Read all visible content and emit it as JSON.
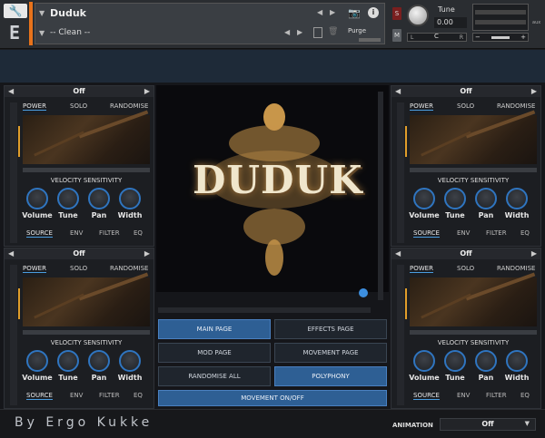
{
  "header": {
    "instrument_name": "Duduk",
    "preset_name": "-- Clean --",
    "purge_label": "Purge",
    "s_label": "S",
    "m_label": "M",
    "tune_label": "Tune",
    "tune_value": "0.00",
    "pan_left": "L",
    "pan_center": "C",
    "pan_right": "R",
    "aux_label": "aux"
  },
  "modules": [
    {
      "selector_value": "Off",
      "tabs": [
        "POWER",
        "SOLO",
        "RANDOMISE"
      ],
      "velocity_title": "VELOCITY SENSITIVITY",
      "knobs": [
        "Volume",
        "Tune",
        "Pan",
        "Width"
      ],
      "bottom_tabs": [
        "SOURCE",
        "ENV",
        "FILTER",
        "EQ"
      ]
    },
    {
      "selector_value": "Off",
      "tabs": [
        "POWER",
        "SOLO",
        "RANDOMISE"
      ],
      "velocity_title": "VELOCITY SENSITIVITY",
      "knobs": [
        "Volume",
        "Tune",
        "Pan",
        "Width"
      ],
      "bottom_tabs": [
        "SOURCE",
        "ENV",
        "FILTER",
        "EQ"
      ]
    },
    {
      "selector_value": "Off",
      "tabs": [
        "POWER",
        "SOLO",
        "RANDOMISE"
      ],
      "velocity_title": "VELOCITY SENSITIVITY",
      "knobs": [
        "Volume",
        "Tune",
        "Pan",
        "Width"
      ],
      "bottom_tabs": [
        "SOURCE",
        "ENV",
        "FILTER",
        "EQ"
      ]
    },
    {
      "selector_value": "Off",
      "tabs": [
        "POWER",
        "SOLO",
        "RANDOMISE"
      ],
      "velocity_title": "VELOCITY SENSITIVITY",
      "knobs": [
        "Volume",
        "Tune",
        "Pan",
        "Width"
      ],
      "bottom_tabs": [
        "SOURCE",
        "ENV",
        "FILTER",
        "EQ"
      ]
    }
  ],
  "center": {
    "logo_text": "DUDUK",
    "buttons": [
      "MAIN PAGE",
      "EFFECTS PAGE",
      "MOD PAGE",
      "MOVEMENT PAGE",
      "RANDOMISE ALL",
      "POLYPHONY",
      "MOVEMENT ON/OFF"
    ]
  },
  "footer": {
    "author": "By Ergo Kukke",
    "animation_label": "ANIMATION",
    "animation_value": "Off"
  },
  "colors": {
    "accent_blue": "#2e5f94",
    "accent_orange": "#e8731b",
    "gold": "#c8964a"
  }
}
